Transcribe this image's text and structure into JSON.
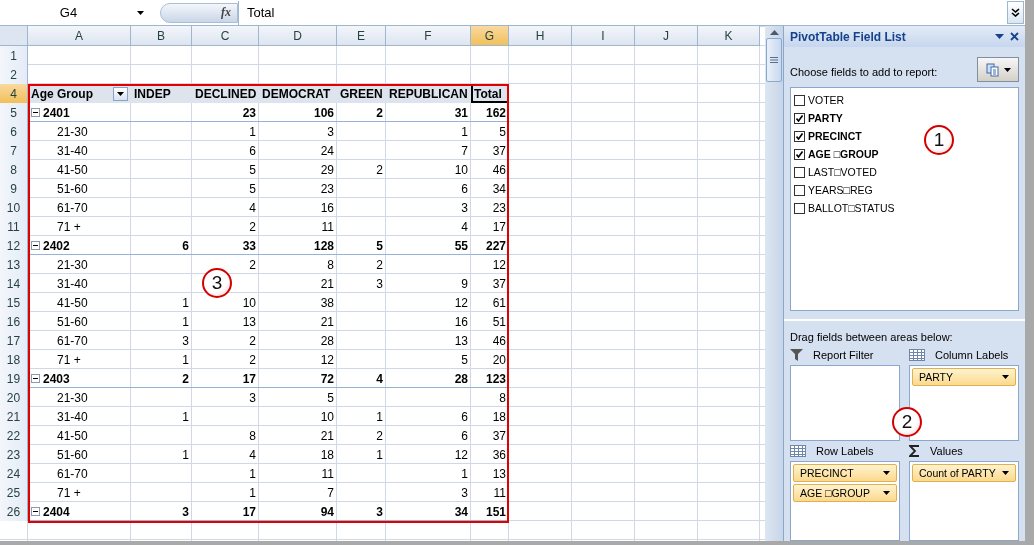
{
  "formula_bar": {
    "name_box": "G4",
    "function_button": "fx",
    "formula": "Total"
  },
  "sheet": {
    "columns": [
      {
        "label": "A",
        "selected": false
      },
      {
        "label": "B",
        "selected": false
      },
      {
        "label": "C",
        "selected": false
      },
      {
        "label": "D",
        "selected": false
      },
      {
        "label": "E",
        "selected": false
      },
      {
        "label": "F",
        "selected": false
      },
      {
        "label": "G",
        "selected": true
      },
      {
        "label": "H",
        "selected": false
      },
      {
        "label": "I",
        "selected": false
      },
      {
        "label": "J",
        "selected": false
      },
      {
        "label": "K",
        "selected": false
      }
    ],
    "callout": "3",
    "rows": [
      {
        "number": "1",
        "selected": false,
        "kind": "blank"
      },
      {
        "number": "2",
        "selected": false,
        "kind": "blank"
      },
      {
        "number": "4",
        "selected": true,
        "kind": "header",
        "label": "Age Group",
        "columns": [
          {
            "text": "INDEP",
            "active": false
          },
          {
            "text": "DECLINED",
            "active": false
          },
          {
            "text": "DEMOCRAT",
            "active": false
          },
          {
            "text": "GREEN",
            "active": false
          },
          {
            "text": "REPUBLICAN",
            "active": false
          },
          {
            "text": "Total",
            "active": true
          }
        ]
      },
      {
        "number": "5",
        "selected": false,
        "kind": "group",
        "expanded": true,
        "label": "2401",
        "values": {
          "declined": "23",
          "democrat": "106",
          "green": "2",
          "republican": "31",
          "total": "162"
        }
      },
      {
        "number": "6",
        "selected": false,
        "kind": "item",
        "label": "21-30",
        "values": {
          "declined": "1",
          "democrat": "3",
          "republican": "1",
          "total": "5"
        }
      },
      {
        "number": "7",
        "selected": false,
        "kind": "item",
        "label": "31-40",
        "values": {
          "declined": "6",
          "democrat": "24",
          "republican": "7",
          "total": "37"
        }
      },
      {
        "number": "8",
        "selected": false,
        "kind": "item",
        "label": "41-50",
        "values": {
          "declined": "5",
          "democrat": "29",
          "green": "2",
          "republican": "10",
          "total": "46"
        }
      },
      {
        "number": "9",
        "selected": false,
        "kind": "item",
        "label": "51-60",
        "values": {
          "declined": "5",
          "democrat": "23",
          "republican": "6",
          "total": "34"
        }
      },
      {
        "number": "10",
        "selected": false,
        "kind": "item",
        "label": "61-70",
        "values": {
          "declined": "4",
          "democrat": "16",
          "republican": "3",
          "total": "23"
        }
      },
      {
        "number": "11",
        "selected": false,
        "kind": "item",
        "label": "71 +",
        "values": {
          "declined": "2",
          "democrat": "11",
          "republican": "4",
          "total": "17"
        }
      },
      {
        "number": "12",
        "selected": false,
        "kind": "group",
        "expanded": true,
        "label": "2402",
        "values": {
          "indep": "6",
          "declined": "33",
          "democrat": "128",
          "green": "5",
          "republican": "55",
          "total": "227"
        }
      },
      {
        "number": "13",
        "selected": false,
        "kind": "item",
        "label": "21-30",
        "values": {
          "declined": "2",
          "democrat": "8",
          "green": "2",
          "total": "12"
        }
      },
      {
        "number": "14",
        "selected": false,
        "kind": "item",
        "label": "31-40",
        "values": {
          "democrat": "21",
          "green": "3",
          "republican": "9",
          "total": "37"
        }
      },
      {
        "number": "15",
        "selected": false,
        "kind": "item",
        "label": "41-50",
        "values": {
          "indep": "1",
          "declined": "10",
          "democrat": "38",
          "republican": "12",
          "total": "61"
        }
      },
      {
        "number": "16",
        "selected": false,
        "kind": "item",
        "label": "51-60",
        "values": {
          "indep": "1",
          "declined": "13",
          "democrat": "21",
          "republican": "16",
          "total": "51"
        }
      },
      {
        "number": "17",
        "selected": false,
        "kind": "item",
        "label": "61-70",
        "values": {
          "indep": "3",
          "declined": "2",
          "democrat": "28",
          "republican": "13",
          "total": "46"
        }
      },
      {
        "number": "18",
        "selected": false,
        "kind": "item",
        "label": "71 +",
        "values": {
          "indep": "1",
          "declined": "2",
          "democrat": "12",
          "republican": "5",
          "total": "20"
        }
      },
      {
        "number": "19",
        "selected": false,
        "kind": "group",
        "expanded": true,
        "label": "2403",
        "values": {
          "indep": "2",
          "declined": "17",
          "democrat": "72",
          "green": "4",
          "republican": "28",
          "total": "123"
        }
      },
      {
        "number": "20",
        "selected": false,
        "kind": "item",
        "label": "21-30",
        "values": {
          "declined": "3",
          "democrat": "5",
          "total": "8"
        }
      },
      {
        "number": "21",
        "selected": false,
        "kind": "item",
        "label": "31-40",
        "values": {
          "indep": "1",
          "democrat": "10",
          "green": "1",
          "republican": "6",
          "total": "18"
        }
      },
      {
        "number": "22",
        "selected": false,
        "kind": "item",
        "label": "41-50",
        "values": {
          "declined": "8",
          "democrat": "21",
          "green": "2",
          "republican": "6",
          "total": "37"
        }
      },
      {
        "number": "23",
        "selected": false,
        "kind": "item",
        "label": "51-60",
        "values": {
          "indep": "1",
          "declined": "4",
          "democrat": "18",
          "green": "1",
          "republican": "12",
          "total": "36"
        }
      },
      {
        "number": "24",
        "selected": false,
        "kind": "item",
        "label": "61-70",
        "values": {
          "declined": "1",
          "democrat": "11",
          "republican": "1",
          "total": "13"
        }
      },
      {
        "number": "25",
        "selected": false,
        "kind": "item",
        "label": "71 +",
        "values": {
          "declined": "1",
          "democrat": "7",
          "republican": "3",
          "total": "11"
        }
      },
      {
        "number": "26",
        "selected": false,
        "kind": "group",
        "expanded": true,
        "label": "2404",
        "values": {
          "indep": "3",
          "declined": "17",
          "democrat": "94",
          "green": "3",
          "republican": "34",
          "total": "151"
        }
      }
    ]
  },
  "field_list": {
    "title": "PivotTable Field List",
    "prompt": "Choose fields to add to report:",
    "callout": "1",
    "fields": [
      {
        "name": "VOTER",
        "checked": false
      },
      {
        "name": "PARTY",
        "checked": true
      },
      {
        "name": "PRECINCT",
        "checked": true
      },
      {
        "name": "AGE □GROUP",
        "checked": true
      },
      {
        "name": "LAST□VOTED",
        "checked": false
      },
      {
        "name": "YEARS□REG",
        "checked": false
      },
      {
        "name": "BALLOT□STATUS",
        "checked": false
      }
    ],
    "areas_prompt": "Drag fields between areas below:",
    "areas_callout": "2",
    "areas": [
      {
        "title": "Report Filter",
        "kind": "filter"
      },
      {
        "title": "Column Labels",
        "kind": "grid",
        "fields": [
          "PARTY"
        ]
      },
      {
        "title": "Row Labels",
        "kind": "grid",
        "fields": [
          "PRECINCT",
          "AGE □GROUP"
        ]
      },
      {
        "title": "Values",
        "kind": "sigma",
        "fields": [
          "Count of PARTY"
        ]
      }
    ]
  }
}
